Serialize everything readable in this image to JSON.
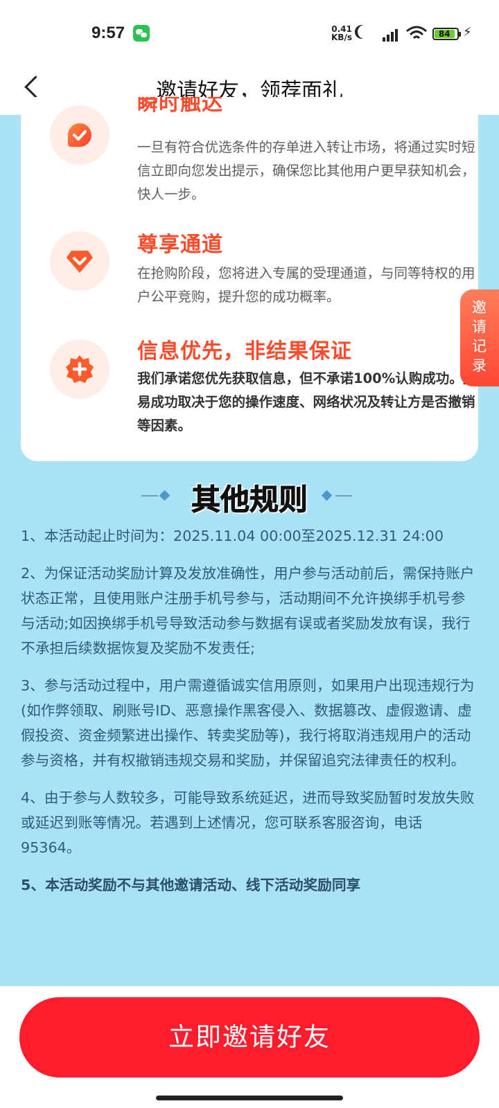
{
  "status_bar": {
    "time": "9:57",
    "net_speed_value": "0.41",
    "net_speed_unit": "KB/s",
    "battery": "84"
  },
  "nav": {
    "title": "邀请好友，领荐面礼"
  },
  "features": [
    {
      "title": "瞬时触达",
      "desc": "一旦有符合优选条件的存单进入转让市场，将通过实时短信立即向您发出提示，确保您比其他用户更早获知机会，快人一步。",
      "icon": "check-bubble-icon"
    },
    {
      "title": "尊享通道",
      "desc": "在抢购阶段，您将进入专属的受理通道，与同等特权的用户公平竞购，提升您的成功概率。",
      "icon": "diamond-icon"
    },
    {
      "title": "信息优先，非结果保证",
      "desc": "我们承诺您优先获取信息，但不承诺100%认购成功。交易成功取决于您的操作速度、网络状况及转让方是否撤销等因素。",
      "icon": "plus-badge-icon"
    }
  ],
  "side_tab": {
    "label": "邀请记录"
  },
  "rules": {
    "title": "其他规则",
    "items": [
      "1、本活动起止时间为：2025.11.04 00:00至2025.12.31 24:00",
      "2、为保证活动奖励计算及发放准确性，用户参与活动前后，需保持账户状态正常，且使用账户注册手机号参与，活动期间不允许换绑手机号参与活动;如因换绑手机号导致活动参与数据有误或者奖励发放有误，我行不承担后续数据恢复及奖励不发责任;",
      "3、参与活动过程中，用户需遵循诚实信用原则，如果用户出现违规行为(如作弊领取、刷账号ID、恶意操作黑客侵入、数据篡改、虚假邀请、虚假投资、资金频繁进出操作、转卖奖励等)，我行将取消违规用户的活动参与资格，并有权撤销违规交易和奖励，并保留追究法律责任的权利。",
      "4、由于参与人数较多，可能导致系统延迟，进而导致奖励暂时发放失败或延迟到账等情况。若遇到上述情况，您可联系客服咨询，电话95364。",
      "5、本活动奖励不与其他邀请活动、线下活动奖励同享"
    ]
  },
  "cta": {
    "label": "立即邀请好友"
  },
  "colors": {
    "page_bg": "#a9e2f6",
    "accent": "#ff1d2d",
    "feature_title": "#ff4a2a",
    "rule_text": "#2e5b7f"
  }
}
